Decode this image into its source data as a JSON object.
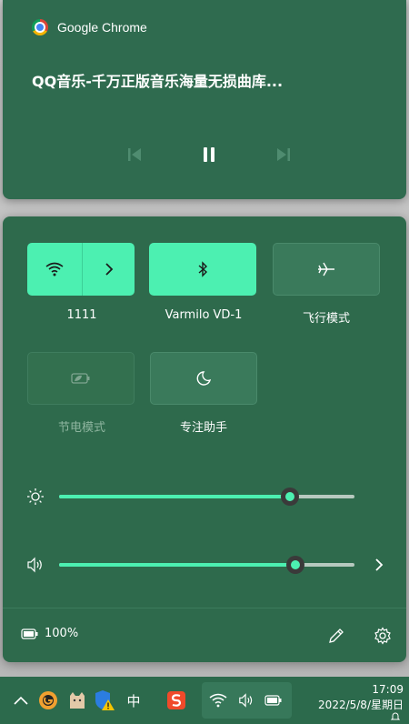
{
  "media": {
    "app_name": "Google Chrome",
    "title": "QQ音乐-千万正版音乐海量无损曲库..."
  },
  "quick_settings": {
    "tiles": [
      {
        "label": "1111",
        "state": "on"
      },
      {
        "label": "Varmilo VD-1",
        "state": "on"
      },
      {
        "label": "飞行模式",
        "state": "off"
      },
      {
        "label": "节电模式",
        "state": "disabled"
      },
      {
        "label": "专注助手",
        "state": "off"
      }
    ],
    "brightness": 0.78,
    "volume": 0.8,
    "battery_text": "100%"
  },
  "taskbar": {
    "ime_label": "中",
    "time": "17:09",
    "date": "2022/5/8/星期日"
  },
  "colors": {
    "accent": "#4cf0b1",
    "panel": "#2e6a4c"
  }
}
